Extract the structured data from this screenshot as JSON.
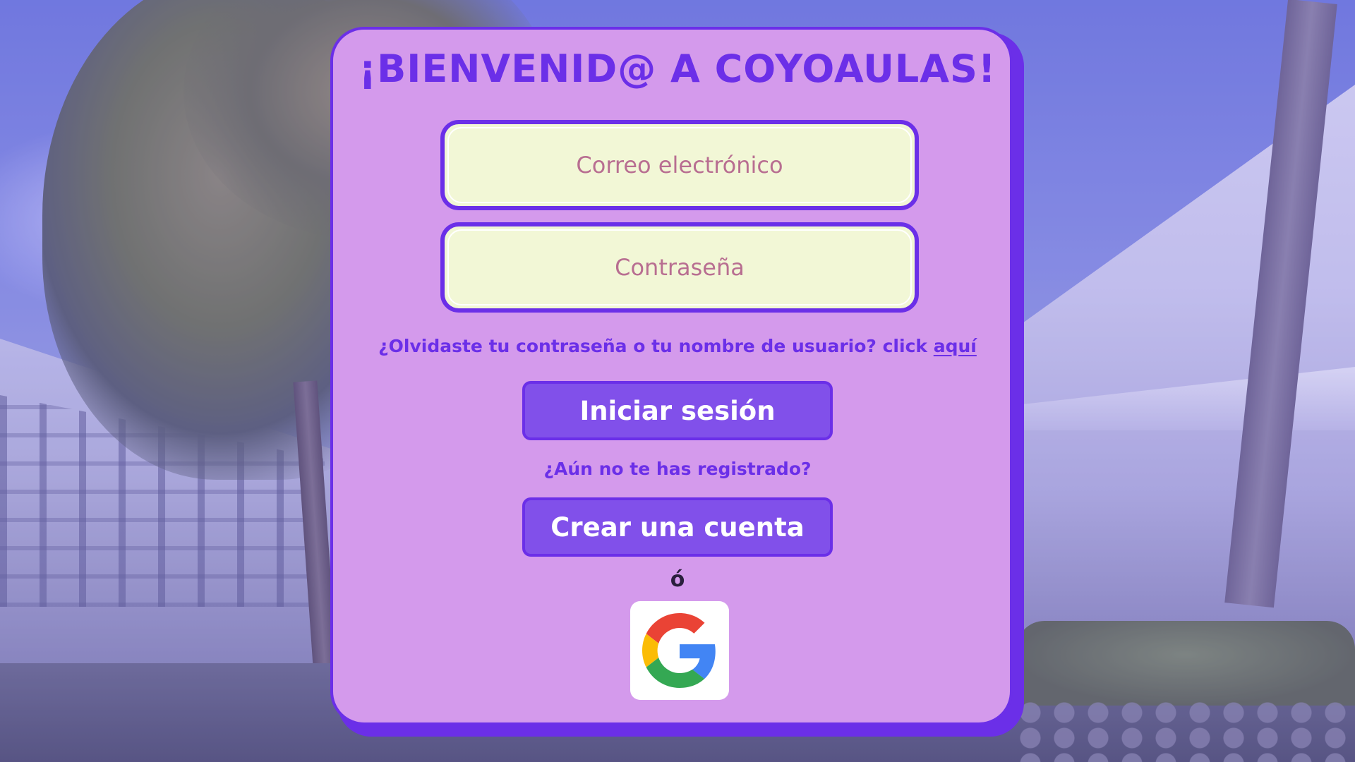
{
  "welcome": {
    "title": "¡BIENVENID@ A COYOAULAS!"
  },
  "form": {
    "email_placeholder": "Correo electrónico",
    "password_placeholder": "Contraseña"
  },
  "forgot": {
    "text": "¿Olvidaste tu contraseña o tu nombre de usuario? click ",
    "link_label": "aquí"
  },
  "buttons": {
    "login_label": "Iniciar sesión",
    "create_account_label": "Crear una cuenta"
  },
  "register_prompt": "¿Aún no te has registrado?",
  "or_label": "ó",
  "google": {
    "icon": "google-logo-icon"
  },
  "colors": {
    "accent": "#6b2fe8",
    "card_bg": "#d49aec",
    "button_bg": "#8150ea",
    "field_bg": "#f2f7d6",
    "placeholder": "#b86e91"
  }
}
